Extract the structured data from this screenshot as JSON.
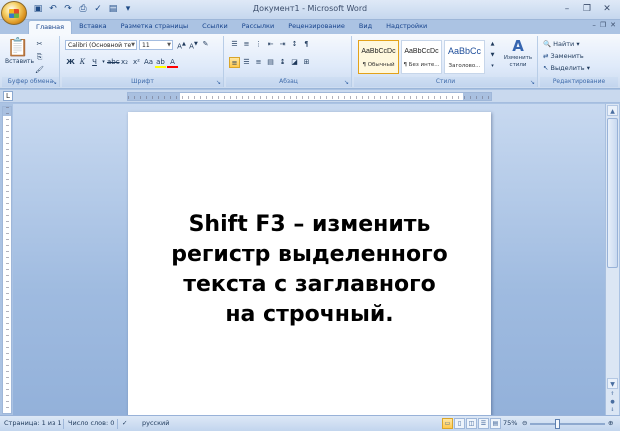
{
  "window": {
    "title": "Документ1 - Microsoft Word"
  },
  "quick_access": [
    "save-icon",
    "undo-icon",
    "redo-icon",
    "print-icon",
    "spelling-icon",
    "open-icon",
    "customize-icon"
  ],
  "tabs": [
    {
      "label": "Главная",
      "active": true
    },
    {
      "label": "Вставка"
    },
    {
      "label": "Разметка страницы"
    },
    {
      "label": "Ссылки"
    },
    {
      "label": "Рассылки"
    },
    {
      "label": "Рецензирование"
    },
    {
      "label": "Вид"
    },
    {
      "label": "Надстройки"
    }
  ],
  "ribbon": {
    "clipboard": {
      "label": "Буфер обмена",
      "paste": "Вставить"
    },
    "font": {
      "label": "Шрифт",
      "family": "Calibri (Основной те",
      "size": "11"
    },
    "paragraph": {
      "label": "Абзац"
    },
    "styles": {
      "label": "Стили",
      "items": [
        {
          "preview": "AaBbCcDc",
          "name": "¶ Обычный"
        },
        {
          "preview": "AaBbCcDc",
          "name": "¶ Без инте..."
        },
        {
          "preview": "AaBbCc",
          "name": "Заголово..."
        }
      ],
      "change": "Изменить стили"
    },
    "editing": {
      "label": "Редактирование",
      "find": "Найти",
      "replace": "Заменить",
      "select": "Выделить"
    }
  },
  "document": {
    "lines": [
      "Shift F3 – изменить",
      "регистр выделенного",
      "текста с заглавного",
      "на строчный."
    ]
  },
  "status": {
    "page": "Страница: 1 из 1",
    "words": "Число слов: 0",
    "language": "русский",
    "zoom": "75%",
    "zoom_level": 0.75
  },
  "colors": {
    "highlight": "#ffff00",
    "font_color": "#ff0000",
    "accent": "#15428b"
  }
}
